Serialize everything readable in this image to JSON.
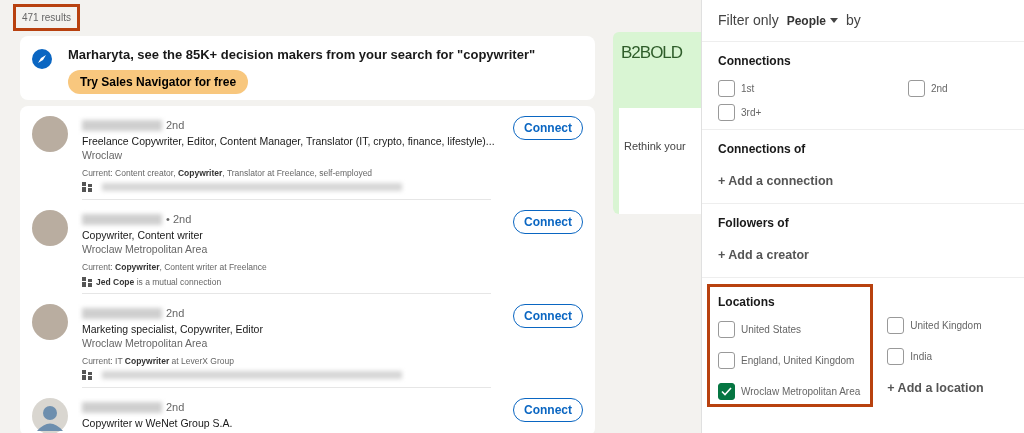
{
  "results_count": {
    "text": "471 results",
    "highlighted": true
  },
  "promo": {
    "message": "Marharyta, see the 85K+ decision makers from your search for \"copywriter\"",
    "button": "Try Sales Navigator for free"
  },
  "people": [
    {
      "degree": "2nd",
      "headline": "Freelance Copywriter, Editor, Content Manager, Translator (IT, crypto, finance, lifestyle)...",
      "location": "Wroclaw",
      "current": "Current: Content creator, **Copywriter**, Translator at Freelance, self-employed",
      "mutual_blurred": true,
      "kind": "photo",
      "button": "Connect"
    },
    {
      "degree": "• 2nd",
      "headline": "Copywriter, Content writer",
      "location": "Wroclaw Metropolitan Area",
      "current": "Current: **Copywriter**, Content writer at Freelance",
      "mutual": "**Jed Cope** is a mutual connection",
      "kind": "photo",
      "button": "Connect"
    },
    {
      "degree": "2nd",
      "headline": "Marketing specialist, Copywriter, Editor",
      "location": "Wroclaw Metropolitan Area",
      "current": "Current: IT **Copywriter** at LeverX Group",
      "mutual_blurred": true,
      "kind": "photo",
      "button": "Connect"
    },
    {
      "degree": "2nd",
      "headline": "Copywriter w WeNet Group S.A.",
      "kind": "silhouette",
      "button": "Connect"
    }
  ],
  "ad": {
    "brand": "B2BOLD",
    "text": "Rethink your"
  },
  "filter": {
    "prefix": "Filter only",
    "dropdown": "People",
    "suffix": "by",
    "sections": [
      {
        "title": "Connections",
        "kind": "checkboxes",
        "options": [
          {
            "label": "1st",
            "checked": false
          },
          {
            "label": "2nd",
            "checked": false
          },
          {
            "label": "3rd+",
            "checked": false
          }
        ]
      },
      {
        "title": "Connections of",
        "kind": "add",
        "add": "+ Add a connection"
      },
      {
        "title": "Followers of",
        "kind": "add",
        "add": "+ Add a creator"
      },
      {
        "title": "Locations",
        "kind": "locations",
        "highlighted": true,
        "options": [
          {
            "label": "United States",
            "checked": false
          },
          {
            "label": "United Kingdom",
            "checked": false
          },
          {
            "label": "England, United Kingdom",
            "checked": false
          },
          {
            "label": "India",
            "checked": false
          },
          {
            "label": "Wroclaw Metropolitan Area",
            "checked": true
          }
        ],
        "add": "+ Add a location"
      }
    ]
  }
}
